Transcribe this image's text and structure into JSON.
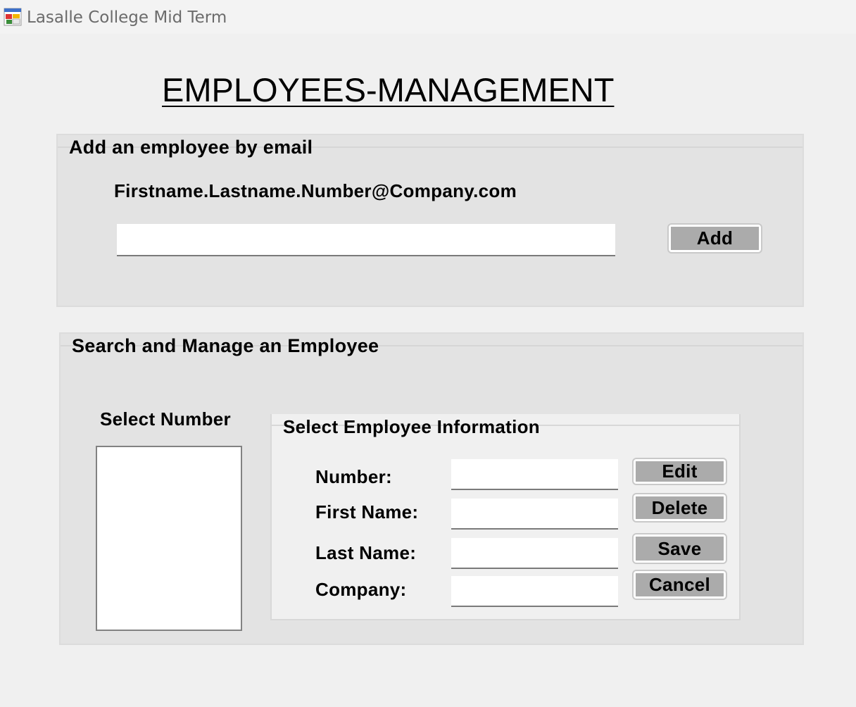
{
  "window": {
    "title": "Lasalle College Mid Term",
    "icon": "winforms-app-icon"
  },
  "page_title": "EMPLOYEES-MANAGEMENT",
  "add_group": {
    "legend": "Add an employee by email",
    "format_hint": "Firstname.Lastname.Number@Company.com",
    "email_input": {
      "value": "",
      "placeholder": ""
    },
    "add_button": "Add"
  },
  "search_group": {
    "legend": "Search and Manage an Employee",
    "select_number_label": "Select Number",
    "number_list": [],
    "info_group": {
      "legend": "Select Employee Information",
      "fields": [
        {
          "label": "Number:",
          "value": ""
        },
        {
          "label": "First Name:",
          "value": ""
        },
        {
          "label": "Last Name:",
          "value": ""
        },
        {
          "label": "Company:",
          "value": ""
        }
      ],
      "buttons": {
        "edit": "Edit",
        "delete": "Delete",
        "save": "Save",
        "cancel": "Cancel"
      }
    }
  },
  "colors": {
    "window_bg": "#f0f0f0",
    "groupbox_bg": "#e3e3e3",
    "button_face": "#ababab"
  }
}
